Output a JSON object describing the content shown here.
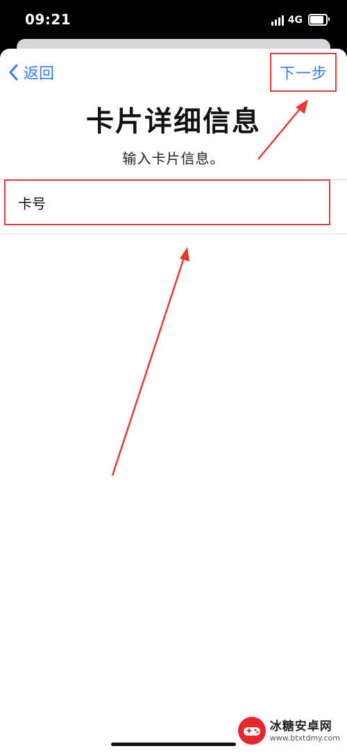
{
  "status_bar": {
    "time": "09:21",
    "network": "4G",
    "battery_level": 0.85
  },
  "nav": {
    "back_label": "返回",
    "next_label": "下一步"
  },
  "page": {
    "title": "卡片详细信息",
    "subtitle": "输入卡片信息。"
  },
  "form": {
    "card_number_label": "卡号",
    "card_number_value": ""
  },
  "watermark": {
    "title": "冰糖安卓网",
    "url": "www.btxtdmy.com"
  },
  "colors": {
    "accent": "#2f7cf6",
    "annotation": "#e53935"
  },
  "icons": {
    "back": "chevron-left-icon",
    "signal": "signal-bars-icon",
    "battery": "battery-icon"
  }
}
